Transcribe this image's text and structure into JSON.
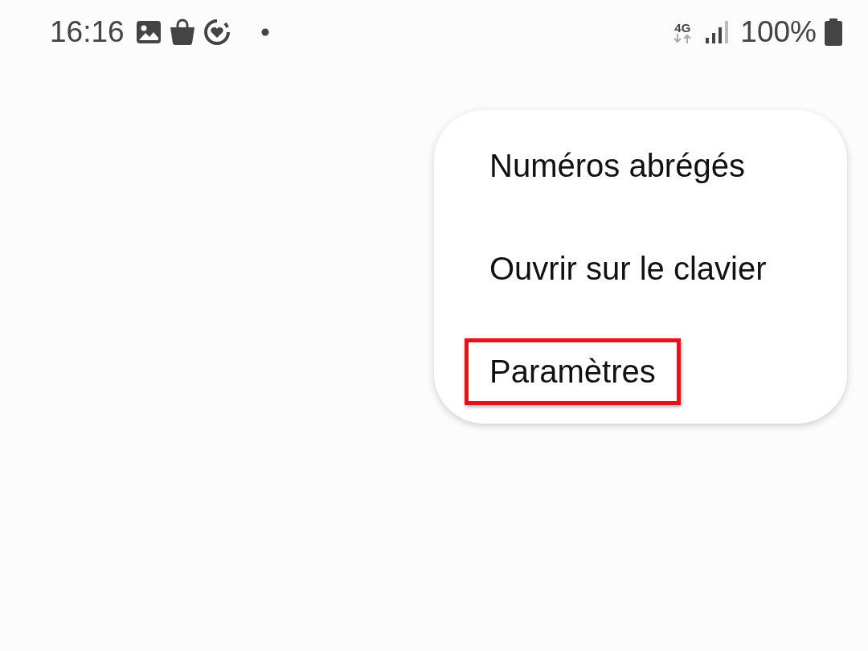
{
  "status_bar": {
    "time": "16:16",
    "network": "4G",
    "battery": "100%"
  },
  "menu": {
    "items": [
      {
        "label": "Numéros abrégés",
        "highlighted": false
      },
      {
        "label": "Ouvrir sur le clavier",
        "highlighted": false
      },
      {
        "label": "Paramètres",
        "highlighted": true
      }
    ]
  }
}
